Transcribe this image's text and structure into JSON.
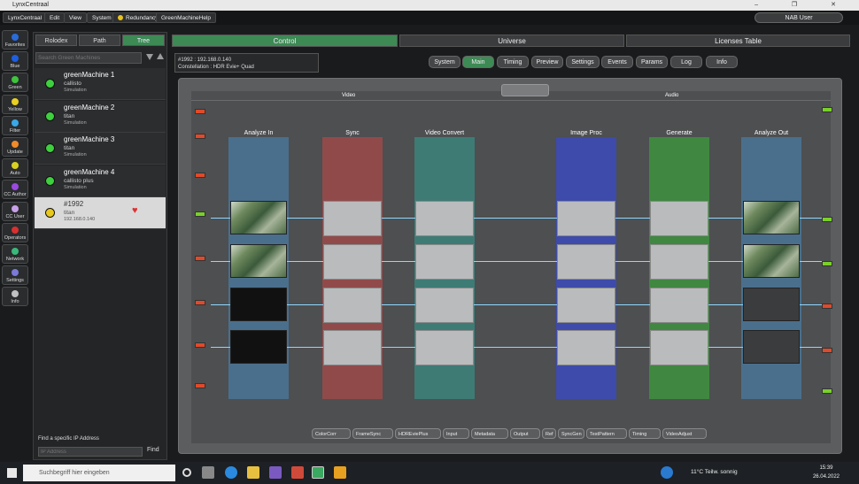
{
  "window": {
    "title": "LynxCentraal",
    "controls": "–  ❐  ✕"
  },
  "menubar": {
    "items": [
      "LynxCentraal",
      "Edit",
      "View",
      "System",
      "Redundancy",
      "GreenMachineHelp"
    ],
    "user": "NAB User"
  },
  "left_tools": [
    {
      "label": "Favorites",
      "color": "#2a6bd8"
    },
    {
      "label": "Blue",
      "color": "#1e5fe0"
    },
    {
      "label": "Green",
      "color": "#3ec43e"
    },
    {
      "label": "Yellow",
      "color": "#e8d020"
    },
    {
      "label": "Filter",
      "color": "#3aa8e8"
    },
    {
      "label": "Update",
      "color": "#f08a2a"
    },
    {
      "label": "Auto",
      "color": "#d8d020"
    },
    {
      "label": "CC Author",
      "color": "#9a4ae0"
    },
    {
      "label": "CC User",
      "color": "#c8a0e8"
    },
    {
      "label": "Operators",
      "color": "#d83030"
    },
    {
      "label": "Network",
      "color": "#3ab87a"
    },
    {
      "label": "Settings",
      "color": "#7a7ad8"
    },
    {
      "label": "Info",
      "color": "#c0c0c0"
    }
  ],
  "left_panel": {
    "tabs": [
      "Rolodex",
      "Path",
      "Tree"
    ],
    "active_tab": "Tree",
    "search_placeholder": "Search Green Machines",
    "nodes": [
      {
        "name": "greenMachine 1",
        "model": "callisto",
        "sub": "Simulation",
        "status_color": "#3ed03e"
      },
      {
        "name": "greenMachine 2",
        "model": "titan",
        "sub": "Simulation",
        "status_color": "#3ed03e"
      },
      {
        "name": "greenMachine 3",
        "model": "titan",
        "sub": "Simulation",
        "status_color": "#3ed03e"
      },
      {
        "name": "greenMachine 4",
        "model": "callisto plus",
        "sub": "Simulation",
        "status_color": "#3ed03e"
      },
      {
        "name": "#1992",
        "model": "titan",
        "sub": "192.168.0.140",
        "status_color": "#e8c81c"
      }
    ],
    "find_label": "Find a specific IP Address",
    "ip_placeholder": "IP Address",
    "find_button": "Find"
  },
  "main_tabs": [
    "Control",
    "Universe",
    "Licenses Table"
  ],
  "active_main_tab": "Control",
  "constellation": {
    "line1": "#1992 : 192.168.0.140",
    "line2": "Constellation : HDR Evie+ Quad"
  },
  "sub_tabs": [
    "System",
    "Main",
    "Timing",
    "Preview",
    "Settings",
    "Events",
    "Params",
    "Log",
    "Info"
  ],
  "active_sub_tab": "Main",
  "diagram": {
    "section_video": "Video",
    "section_audio": "Audio",
    "columns": [
      {
        "label": "Analyze In",
        "color": "#4a7aa0"
      },
      {
        "label": "Sync",
        "color": "#a84848"
      },
      {
        "label": "Video Convert",
        "color": "#3a8a82"
      },
      {
        "label": "Image Proc",
        "color": "#3a4ac8"
      },
      {
        "label": "Generate",
        "color": "#3c9a3c"
      },
      {
        "label": "Analyze Out",
        "color": "#4a7aa0"
      }
    ]
  },
  "func_bar": [
    "ColorCorr",
    "FrameSync",
    "HDREviePlus",
    "Input",
    "Metadata",
    "Output",
    "Ref",
    "SyncGen",
    "TestPattern",
    "Timing",
    "VideoAdjust"
  ],
  "taskbar": {
    "search_placeholder": "Suchbegriff hier eingeben",
    "weather": "11°C  Teilw. sonnig",
    "time": "15:39",
    "date": "26.04.2022"
  }
}
